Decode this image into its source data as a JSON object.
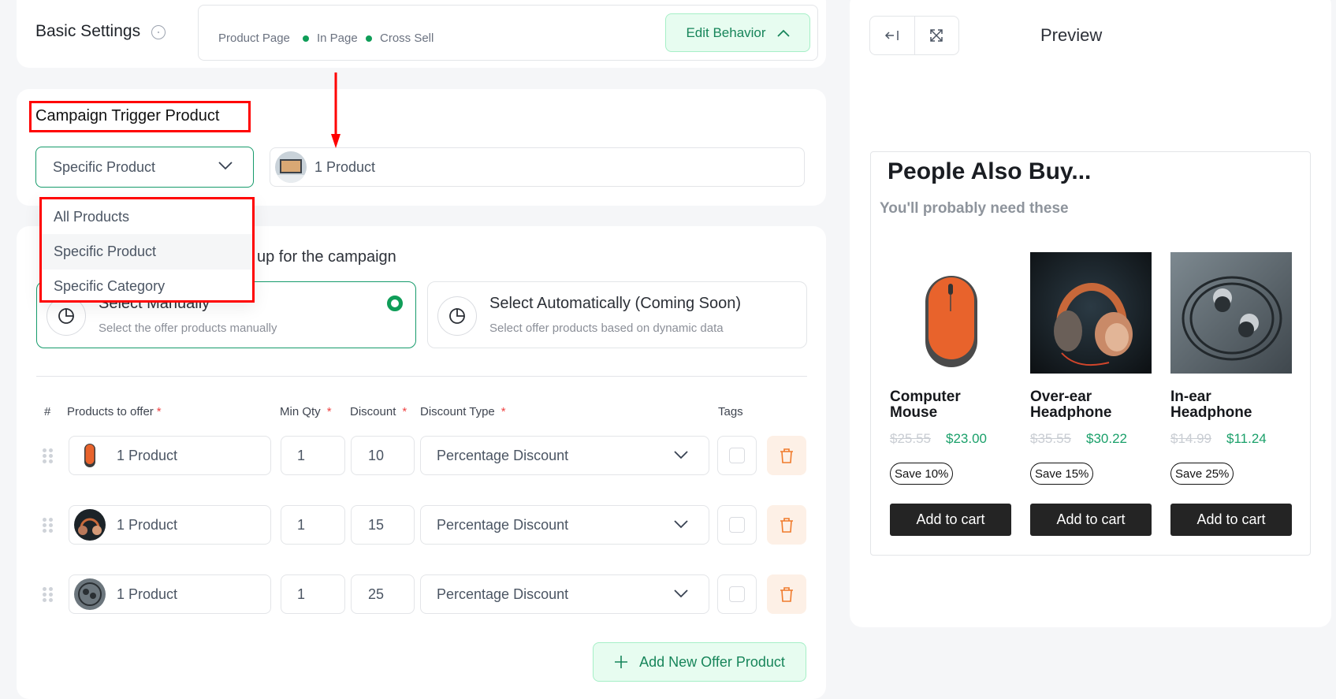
{
  "basic_settings": {
    "title": "Basic Settings",
    "breadcrumbs": [
      "Product Page",
      "In Page",
      "Cross Sell"
    ],
    "edit_behavior_label": "Edit Behavior"
  },
  "trigger": {
    "title": "Campaign Trigger Product",
    "selected": "Specific Product",
    "product_label": "1 Product",
    "dropdown_options": [
      "All Products",
      "Specific Product",
      "Specific Category"
    ],
    "highlighted_option": "Specific Product"
  },
  "offer": {
    "heading_visible": "up for the campaign",
    "choices": [
      {
        "title": "Select Manually",
        "subtitle": "Select the offer products manually",
        "selected": true
      },
      {
        "title": "Select Automatically (Coming Soon)",
        "subtitle": "Select offer products based on dynamic data",
        "selected": false
      }
    ],
    "columns": {
      "index": "#",
      "products": "Products to offer",
      "min_qty": "Min Qty",
      "discount": "Discount",
      "discount_type": "Discount Type",
      "tags": "Tags",
      "required_mark": "*"
    },
    "rows": [
      {
        "product_label": "1 Product",
        "thumb": "computer-mouse",
        "min_qty": "1",
        "discount": "10",
        "discount_type": "Percentage Discount",
        "tag_checked": false
      },
      {
        "product_label": "1 Product",
        "thumb": "over-ear-headphone",
        "min_qty": "1",
        "discount": "15",
        "discount_type": "Percentage Discount",
        "tag_checked": false
      },
      {
        "product_label": "1 Product",
        "thumb": "in-ear-headphone",
        "min_qty": "1",
        "discount": "25",
        "discount_type": "Percentage Discount",
        "tag_checked": false
      }
    ],
    "add_button_label": "Add New Offer Product"
  },
  "preview": {
    "title": "Preview",
    "widget": {
      "title": "People Also Buy...",
      "subtitle": "You'll probably need these",
      "products": [
        {
          "name": "Computer Mouse",
          "old_price": "$25.55",
          "new_price": "$23.00",
          "save": "Save 10%",
          "cart_label": "Add to cart"
        },
        {
          "name": "Over-ear Headphone",
          "old_price": "$35.55",
          "new_price": "$30.22",
          "save": "Save 15%",
          "cart_label": "Add to cart"
        },
        {
          "name": "In-ear Headphone",
          "old_price": "$14.99",
          "new_price": "$11.24",
          "save": "Save 25%",
          "cart_label": "Add to cart"
        }
      ]
    }
  },
  "colors": {
    "accent_green": "#0f9d58",
    "accent_green_bg": "#e7fcf0",
    "annotation_red": "#ff0000",
    "delete_orange": "#f07a2b",
    "price_green": "#1aa06a"
  }
}
